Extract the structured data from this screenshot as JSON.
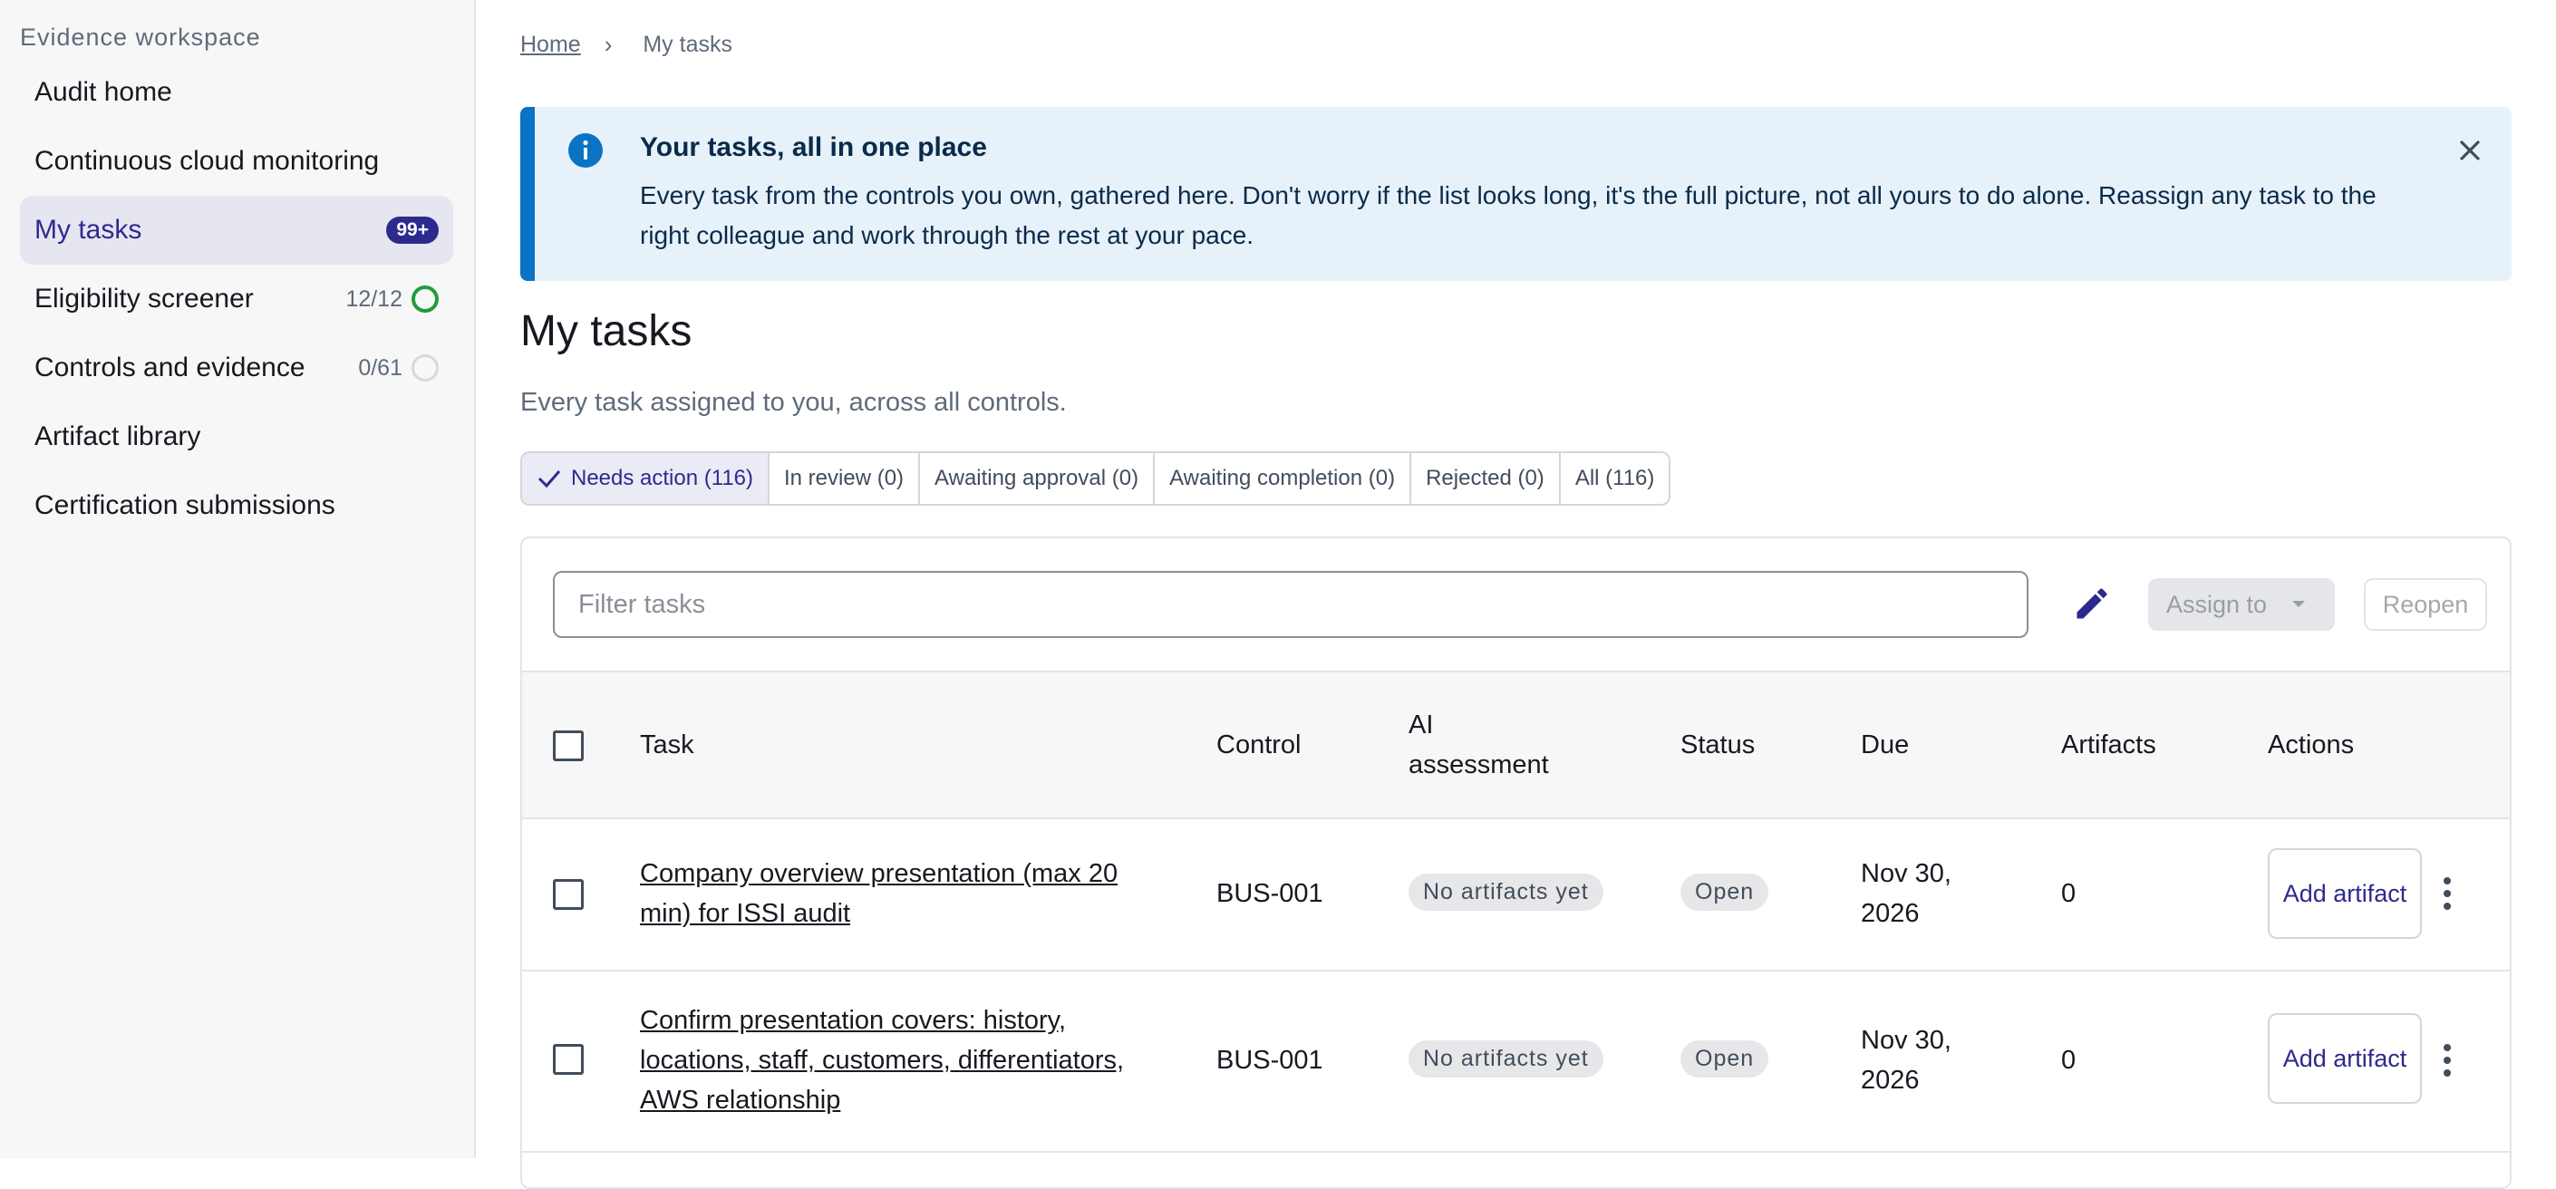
{
  "sidebar": {
    "heading": "Evidence workspace",
    "items": [
      {
        "label": "Audit home"
      },
      {
        "label": "Continuous cloud monitoring"
      },
      {
        "label": "My tasks",
        "badge": "99+",
        "active": true
      },
      {
        "label": "Eligibility screener",
        "count": "12/12",
        "status": "complete"
      },
      {
        "label": "Controls and evidence",
        "count": "0/61",
        "status": "not-started"
      },
      {
        "label": "Artifact library"
      },
      {
        "label": "Certification submissions"
      }
    ]
  },
  "breadcrumb": {
    "home": "Home",
    "current": "My tasks"
  },
  "banner": {
    "title": "Your tasks, all in one place",
    "body": "Every task from the controls you own, gathered here. Don't worry if the list looks long, it's the full picture, not all yours to do alone. Reassign any task to the right colleague and work through the rest at your pace."
  },
  "page": {
    "title": "My tasks",
    "subtitle": "Every task assigned to you, across all controls."
  },
  "tabs": [
    {
      "label": "Needs action (116)",
      "active": true
    },
    {
      "label": "In review (0)"
    },
    {
      "label": "Awaiting approval (0)"
    },
    {
      "label": "Awaiting completion (0)"
    },
    {
      "label": "Rejected (0)"
    },
    {
      "label": "All (116)"
    }
  ],
  "toolbar": {
    "filter_placeholder": "Filter tasks",
    "assign_label": "Assign to",
    "reopen_label": "Reopen"
  },
  "table": {
    "columns": {
      "task": "Task",
      "control": "Control",
      "ai": "AI assessment",
      "status": "Status",
      "due": "Due",
      "artifacts": "Artifacts",
      "actions": "Actions"
    },
    "rows": [
      {
        "task": "Company overview presentation (max 20 min) for ISSI audit",
        "control": "BUS-001",
        "ai": "No artifacts yet",
        "status": "Open",
        "due": "Nov 30, 2026",
        "artifacts": "0",
        "action": "Add artifact"
      },
      {
        "task": "Confirm presentation covers: history, locations, staff, customers, differentiators, AWS relationship",
        "control": "BUS-001",
        "ai": "No artifacts yet",
        "status": "Open",
        "due": "Nov 30, 2026",
        "artifacts": "0",
        "action": "Add artifact"
      }
    ]
  },
  "colors": {
    "accent": "#2d2a8f",
    "info": "#0b73c4",
    "success": "#1f9c3b"
  }
}
